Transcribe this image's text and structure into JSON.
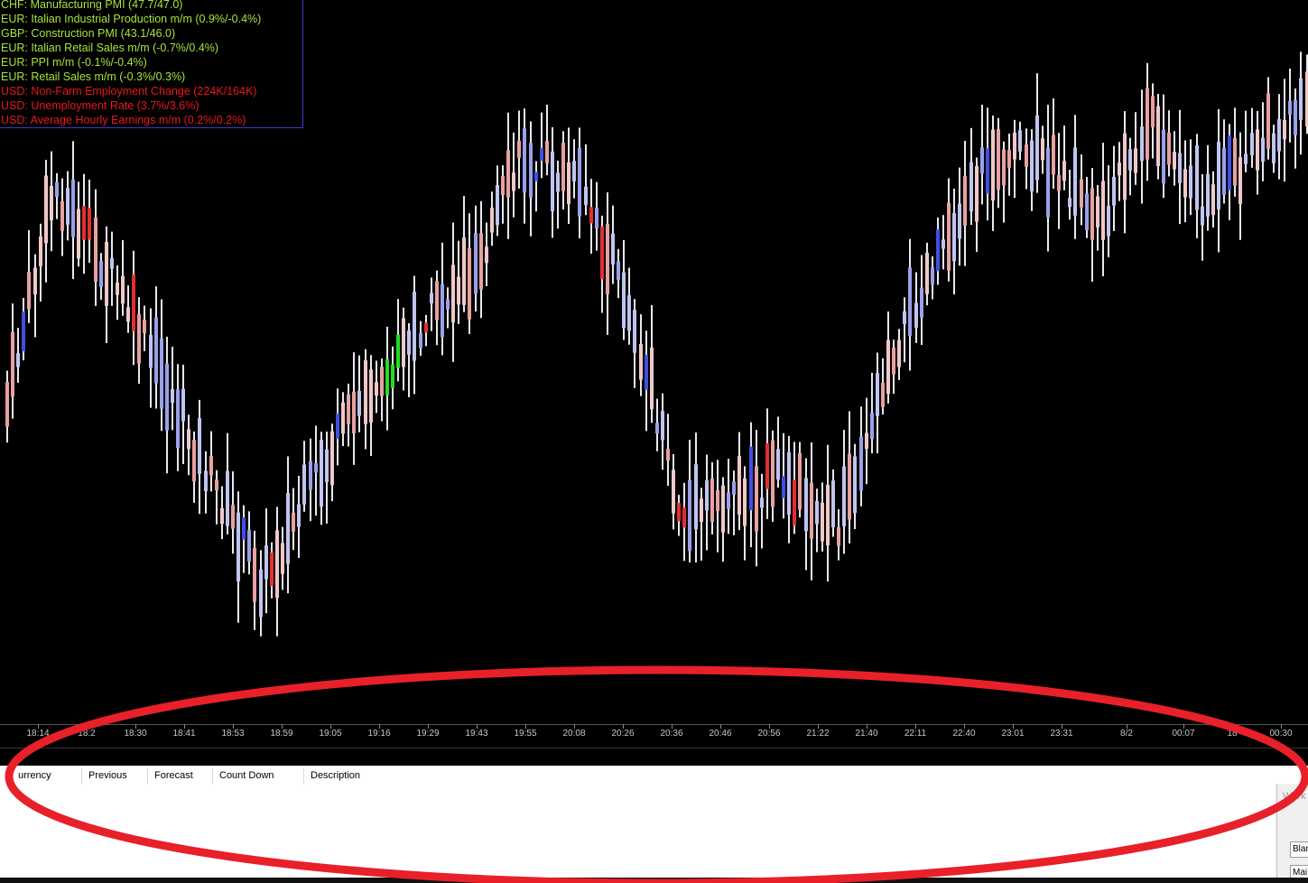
{
  "news_feed": [
    {
      "text": "CHF: Manufacturing PMI (47.7/47.0)",
      "color": "#a8e43c"
    },
    {
      "text": "EUR: Italian Industrial Production m/m (0.9%/-0.4%)",
      "color": "#a8e43c"
    },
    {
      "text": "GBP: Construction PMI (43.1/46.0)",
      "color": "#a8e43c"
    },
    {
      "text": "EUR: Italian Retail Sales m/m (-0.7%/0.4%)",
      "color": "#a8e43c"
    },
    {
      "text": "EUR: PPI m/m (-0.1%/-0.4%)",
      "color": "#a8e43c"
    },
    {
      "text": "EUR: Retail Sales m/m (-0.3%/0.3%)",
      "color": "#a8e43c"
    },
    {
      "text": "USD: Non-Farm Employment Change (224K/164K)",
      "color": "#e8181c"
    },
    {
      "text": "USD: Unemployment Rate (3.7%/3.6%)",
      "color": "#e8181c"
    },
    {
      "text": "USD: Average Hourly Earnings m/m (0.2%/0.2%)",
      "color": "#e8181c"
    }
  ],
  "time_axis": [
    "18:14",
    "18:2",
    "18:30",
    "18:41",
    "18:53",
    "18:59",
    "19:05",
    "19:16",
    "19:29",
    "19:43",
    "19:55",
    "20:08",
    "20:26",
    "20:36",
    "20:46",
    "20:56",
    "21:22",
    "21:40",
    "22:11",
    "22:40",
    "23:01",
    "23:31",
    "8/2",
    "00:07",
    "18",
    "00:30"
  ],
  "events_table": {
    "columns": [
      "urrency",
      "Previous",
      "Forecast",
      "Count Down",
      "Description"
    ],
    "rows": []
  },
  "side_widget": {
    "title": "Work",
    "field1": "Blan",
    "field2": "Mai"
  },
  "colors": {
    "bull": "#c0c4f0",
    "bull_strong": "#4050e0",
    "bear": "#e8a0a0",
    "bear_strong": "#e03030",
    "highlight": "#22dd22",
    "annotation": "#e8202a"
  },
  "chart_data": {
    "type": "candlestick",
    "x": [
      "18:14",
      "18:20",
      "18:30",
      "18:41",
      "18:53",
      "18:59",
      "19:05",
      "19:16",
      "19:29",
      "19:43",
      "19:55",
      "20:08",
      "20:26",
      "20:36",
      "20:46",
      "20:56",
      "21:22",
      "21:40",
      "22:11",
      "22:40",
      "23:01",
      "23:31",
      "8/2",
      "00:07",
      "00:18",
      "00:30"
    ],
    "close_profile": [
      0.4,
      0.88,
      0.72,
      0.52,
      0.3,
      0.1,
      0.3,
      0.48,
      0.6,
      0.72,
      0.95,
      0.88,
      0.65,
      0.22,
      0.28,
      0.3,
      0.22,
      0.55,
      0.78,
      0.95,
      0.92,
      0.82,
      1.0,
      0.85,
      0.95,
      1.08
    ],
    "grid": false,
    "legend": "none"
  }
}
